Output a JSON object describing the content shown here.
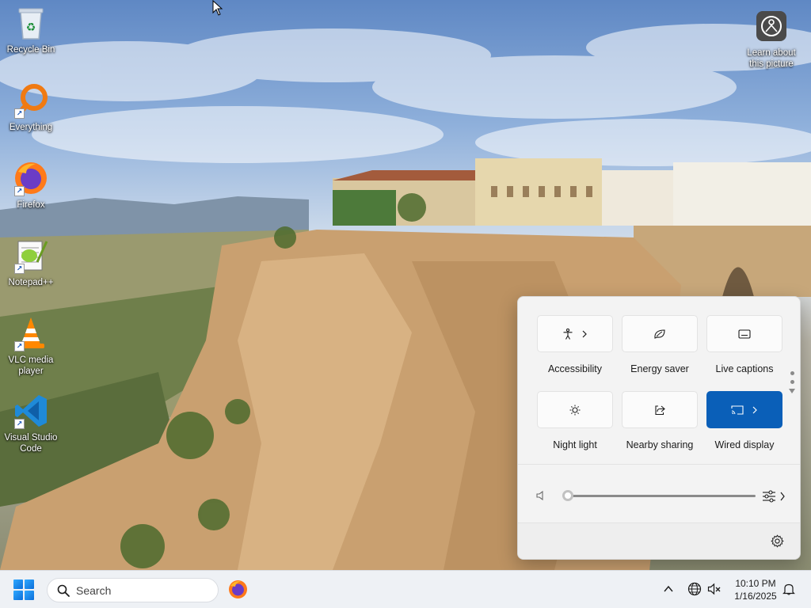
{
  "desktop": {
    "icons": [
      {
        "label": "Recycle Bin",
        "icon": "recycle-bin-icon"
      },
      {
        "label": "Everything",
        "icon": "everything-search-icon"
      },
      {
        "label": "Firefox",
        "icon": "firefox-icon"
      },
      {
        "label": "Notepad++",
        "icon": "notepad-plus-plus-icon"
      },
      {
        "label": "VLC media player",
        "icon": "vlc-cone-icon"
      },
      {
        "label": "Visual Studio Code",
        "icon": "vscode-icon"
      }
    ],
    "spotlight": {
      "label": "Learn about this picture",
      "icon": "camera-spotlight-icon"
    }
  },
  "quick_settings": {
    "tiles": [
      {
        "label": "Accessibility",
        "icon": "accessibility-icon",
        "active": false,
        "has_chevron": true
      },
      {
        "label": "Energy saver",
        "icon": "energy-saver-leaf-icon",
        "active": false,
        "has_chevron": false
      },
      {
        "label": "Live captions",
        "icon": "captions-icon",
        "active": false,
        "has_chevron": false
      },
      {
        "label": "Night light",
        "icon": "night-light-sun-icon",
        "active": false,
        "has_chevron": false
      },
      {
        "label": "Nearby sharing",
        "icon": "share-icon",
        "active": false,
        "has_chevron": false
      },
      {
        "label": "Wired display",
        "icon": "cast-display-icon",
        "active": true,
        "has_chevron": true
      }
    ],
    "volume": {
      "level": 0,
      "icon": "speaker-muted-icon",
      "output_icon": "audio-mixer-icon"
    },
    "settings_icon": "gear-icon",
    "accent_color": "#0a5fb8"
  },
  "taskbar": {
    "search_placeholder": "Search",
    "pinned": [
      {
        "name": "Firefox",
        "icon": "firefox-icon"
      }
    ],
    "tray": {
      "time": "10:10 PM",
      "date": "1/16/2025"
    }
  }
}
